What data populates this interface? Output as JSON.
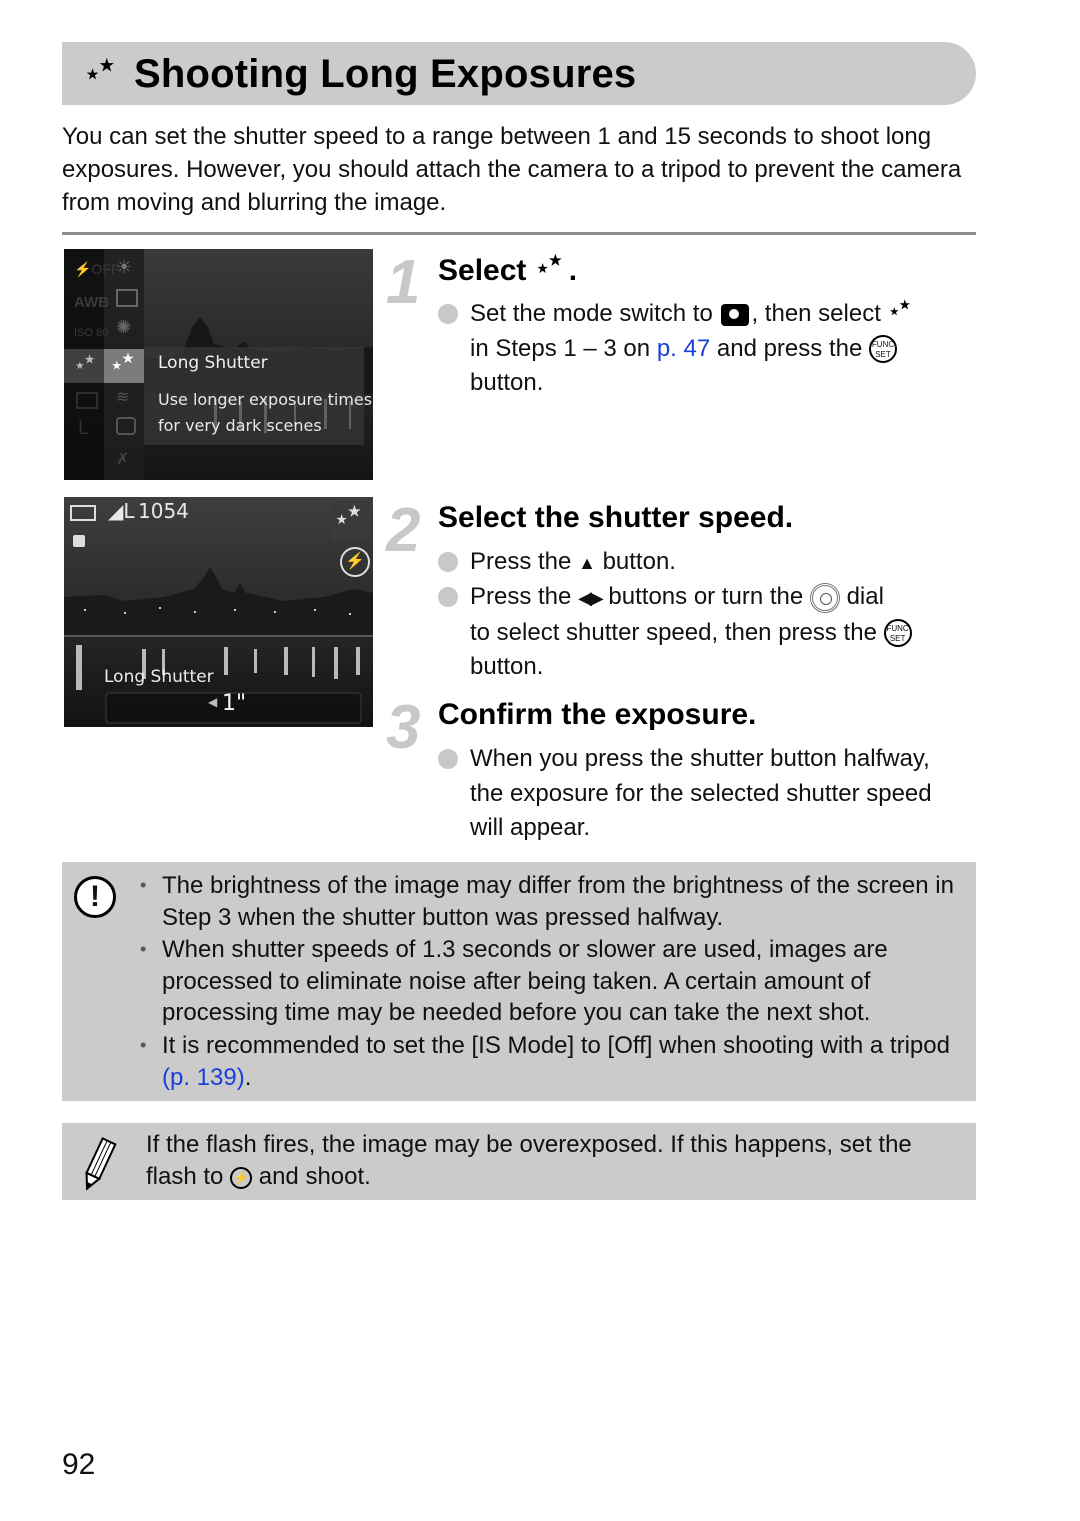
{
  "page": {
    "title": "Shooting Long Exposures",
    "title_icon": "long-shutter-icon",
    "intro": "You can set the shutter speed to a range between 1 and 15 seconds to shoot long exposures. However, you should attach the camera to a tripod to prevent the camera from moving and blurring the image.",
    "page_number": "92"
  },
  "screens": {
    "menu": {
      "left_column_icons": [
        "flash-off-icon",
        "awb-icon",
        "iso-80-icon",
        "long-shutter-icon",
        "aspect-icon",
        "large-size-icon",
        "compression-icon"
      ],
      "left_labels": [
        "⚡OFF",
        "AWB",
        "ISO 80",
        "",
        "",
        "L",
        ""
      ],
      "right_column_icons": [
        "sunset-icon",
        "landscape-icon",
        "fireworks-icon",
        "long-shutter-icon",
        "beach-icon",
        "aquarium-icon",
        "foliage-icon"
      ],
      "selected_title": "Long Shutter",
      "selected_desc_line1": "Use longer exposure times",
      "selected_desc_line2": "for very dark scenes"
    },
    "shooting": {
      "battery_icon": "battery-icon",
      "quality": "L",
      "shots_remaining": "1054",
      "mode_icon": "long-shutter-icon",
      "flash_icon": "flash-off-icon",
      "mode_label": "Long Shutter",
      "shutter_value": "1\""
    }
  },
  "steps": [
    {
      "number": "1",
      "title": "Select",
      "title_icon": "long-shutter-icon",
      "title_suffix": ".",
      "bullets": [
        {
          "parts": {
            "a": "Set the mode switch to",
            "b": ", then select",
            "c": "in Steps 1 – 3 on",
            "link": "p. 47",
            "d": "and press the",
            "e": "button."
          },
          "icons": [
            "camera-icon",
            "long-shutter-icon",
            "func-set-icon"
          ]
        }
      ]
    },
    {
      "number": "2",
      "title": "Select the shutter speed.",
      "bullets": [
        {
          "parts": {
            "a": "Press the",
            "b": "button."
          },
          "icons": [
            "up-arrow-icon"
          ]
        },
        {
          "parts": {
            "a": "Press the",
            "b": "buttons or turn the",
            "c": "dial",
            "d": "to select shutter speed, then press the",
            "e": "button."
          },
          "icons": [
            "left-right-arrows-icon",
            "control-dial-icon",
            "func-set-icon"
          ]
        }
      ]
    },
    {
      "number": "3",
      "title": "Confirm the exposure.",
      "bullets": [
        {
          "text": "When you press the shutter button halfway, the exposure for the selected shutter speed will appear."
        }
      ]
    }
  ],
  "caution": {
    "icon": "caution-icon",
    "items": [
      {
        "text": "The brightness of the image may differ from the brightness of the screen in Step 3 when the shutter button was pressed halfway."
      },
      {
        "text": "When shutter speeds of 1.3 seconds or slower are used, images are processed to eliminate noise after being taken. A certain amount of processing time may be needed before you can take the next shot."
      },
      {
        "text": "It is recommended to set the [IS Mode] to [Off] when shooting with a tripod",
        "link": "(p. 139)",
        "suffix": "."
      }
    ]
  },
  "note": {
    "icon": "pencil-icon",
    "text_a": "If the flash fires, the image may be overexposed. If this happens, set the flash to",
    "text_b": "and shoot.",
    "inline_icon": "flash-off-icon"
  },
  "colors": {
    "title_bar_bg": "#cbcbcb",
    "box_bg": "#cbcbcb",
    "link": "#1a3fd8",
    "step_number": "#c8c8c8",
    "divider": "#8c8c8c"
  }
}
